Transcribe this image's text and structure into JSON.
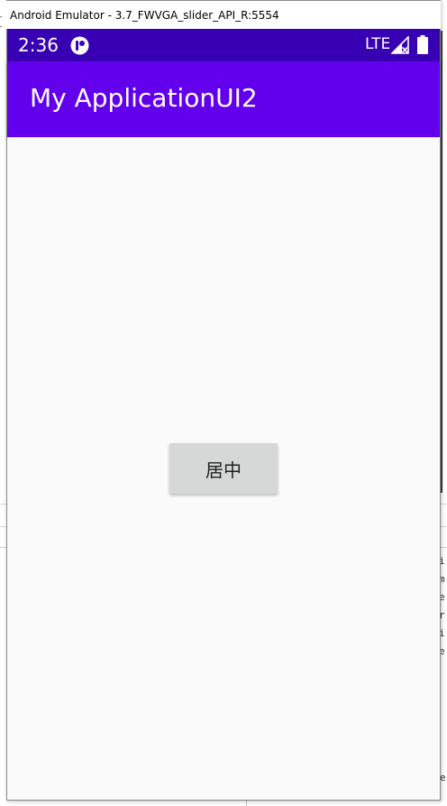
{
  "window": {
    "title": "Android Emulator - 3.7_FWVGA_slider_API_R:5554"
  },
  "status_bar": {
    "time": "2:36",
    "network": "LTE",
    "background_color": "#3700b3",
    "icons": [
      "app-notification-icon",
      "signal-icon",
      "battery-icon"
    ]
  },
  "app_bar": {
    "title": "My ApplicationUI2",
    "background_color": "#6200ee"
  },
  "main": {
    "button_label": "居中",
    "background_color": "#fafafa"
  },
  "background_window": {
    "edge_glyphs": "i\nm\ne\nr\ni\ne",
    "edge_glyph_bottom": "e"
  }
}
